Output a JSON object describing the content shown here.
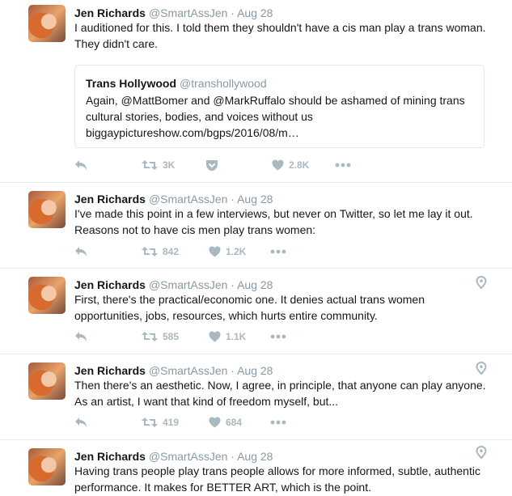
{
  "tweets": [
    {
      "name": "Jen Richards",
      "handle": "@SmartAssJen",
      "separator": "·",
      "time": "Aug 28",
      "text": "I auditioned for this. I told them they shouldn't have a cis man play a trans woman. They didn't care.",
      "quote": {
        "name": "Trans Hollywood",
        "handle": "@transhollywood",
        "text": "Again, @MattBomer and @MarkRuffalo should be ashamed of mining trans cultural stories, bodies, and voices without us biggaypictureshow.com/bgps/2016/08/m…"
      },
      "retweets": "3K",
      "likes": "2.8K"
    },
    {
      "name": "Jen Richards",
      "handle": "@SmartAssJen",
      "separator": "·",
      "time": "Aug 28",
      "text": "I've made this point in a few interviews, but never on Twitter, so let me lay it out. Reasons not to have cis men play trans women:",
      "retweets": "842",
      "likes": "1.2K"
    },
    {
      "name": "Jen Richards",
      "handle": "@SmartAssJen",
      "separator": "·",
      "time": "Aug 28",
      "text": "First, there's the practical/economic one. It denies actual trans women opportunities, jobs, resources, which hurts entire community.",
      "retweets": "585",
      "likes": "1.1K"
    },
    {
      "name": "Jen Richards",
      "handle": "@SmartAssJen",
      "separator": "·",
      "time": "Aug 28",
      "text": "Then there's an aesthetic. Now, I agree, in principle, that anyone can play anyone. As an artist, I want that kind of freedom myself, but...",
      "retweets": "419",
      "likes": "684"
    },
    {
      "name": "Jen Richards",
      "handle": "@SmartAssJen",
      "separator": "·",
      "time": "Aug 28",
      "text": "Having trans people play trans people allows for more informed, subtle, authentic performance. It makes for BETTER ART, which is the point."
    }
  ],
  "icons": {
    "reply": "reply-icon",
    "retweet": "retweet-icon",
    "like": "heart-icon",
    "more": "more-icon",
    "pocket": "pocket-icon",
    "location": "location-pin-icon"
  },
  "colors": {
    "icon_gray": "#aab8c2",
    "handle_gray": "#8899a6",
    "border": "#e6ecf0"
  }
}
